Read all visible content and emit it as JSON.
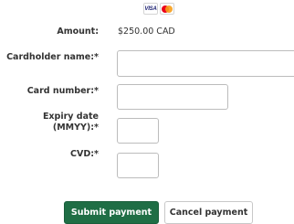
{
  "card_logos": {
    "visa_text": "VISA",
    "visa_icon": "visa-card-logo",
    "mastercard_icon": "mastercard-logo"
  },
  "amount": {
    "label": "Amount:",
    "value": "$250.00 CAD"
  },
  "form": {
    "cardholder_label": "Cardholder name:*",
    "cardholder_value": "",
    "card_number_label": "Card number:*",
    "card_number_value": "",
    "expiry_label_line1": "Expiry date",
    "expiry_label_line2": "(MMYY):*",
    "expiry_value": "",
    "cvd_label": "CVD:*",
    "cvd_value": ""
  },
  "buttons": {
    "submit": "Submit payment",
    "cancel": "Cancel payment"
  },
  "colors": {
    "primary_button": "#1f6e45",
    "text": "#333333",
    "input_border": "#bcbcbc"
  }
}
